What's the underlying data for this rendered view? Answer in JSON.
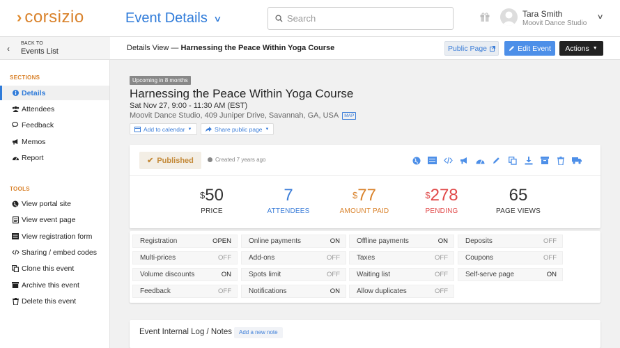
{
  "brand": {
    "name": "corsizio",
    "accent": "#d9822b",
    "link": "#2f7bd9"
  },
  "header": {
    "title": "Event Details",
    "search_placeholder": "Search",
    "user": {
      "name": "Tara Smith",
      "org": "Moovit Dance Studio"
    }
  },
  "sidebar": {
    "back_small": "BACK TO",
    "back_label": "Events List",
    "sections_label": "SECTIONS",
    "sections": [
      {
        "label": "Details",
        "icon": "info-icon"
      },
      {
        "label": "Attendees",
        "icon": "users-icon"
      },
      {
        "label": "Feedback",
        "icon": "comments-icon"
      },
      {
        "label": "Memos",
        "icon": "bullhorn-icon"
      },
      {
        "label": "Report",
        "icon": "dashboard-icon"
      }
    ],
    "tools_label": "TOOLS",
    "tools": [
      {
        "label": "View portal site",
        "icon": "globe-icon"
      },
      {
        "label": "View event page",
        "icon": "page-icon"
      },
      {
        "label": "View registration form",
        "icon": "form-icon"
      },
      {
        "label": "Sharing / embed codes",
        "icon": "code-icon"
      },
      {
        "label": "Clone this event",
        "icon": "copy-icon"
      },
      {
        "label": "Archive this event",
        "icon": "archive-icon"
      },
      {
        "label": "Delete this event",
        "icon": "trash-icon"
      }
    ]
  },
  "toolbar": {
    "crumb_prefix": "Details View — ",
    "crumb_title": "Harnessing the Peace Within Yoga Course",
    "public_page": "Public Page",
    "edit_event": "Edit Event",
    "actions": "Actions"
  },
  "event": {
    "badge": "Upcoming in 8 months",
    "title": "Harnessing the Peace Within Yoga Course",
    "date": "Sat Nov 27, 9:00 - 11:30 AM (EST)",
    "address": "Moovit Dance Studio, 409 Juniper Drive, Savannah, GA, USA",
    "map_label": "MAP",
    "add_calendar": "Add to calendar",
    "share_page": "Share public page"
  },
  "status": {
    "label": "Published",
    "created": "Created 7 years ago"
  },
  "stats": [
    {
      "prefix": "$",
      "value": "50",
      "label": "PRICE",
      "color": "#333333"
    },
    {
      "prefix": "",
      "value": "7",
      "label": "ATTENDEES",
      "color": "#3b7dd8"
    },
    {
      "prefix": "$",
      "value": "77",
      "label": "AMOUNT PAID",
      "color": "#d9822b"
    },
    {
      "prefix": "$",
      "value": "278",
      "label": "PENDING",
      "color": "#e04848"
    },
    {
      "prefix": "",
      "value": "65",
      "label": "PAGE VIEWS",
      "color": "#333333"
    }
  ],
  "features": [
    {
      "label": "Registration",
      "value": "OPEN"
    },
    {
      "label": "Online payments",
      "value": "ON"
    },
    {
      "label": "Offline payments",
      "value": "ON"
    },
    {
      "label": "Deposits",
      "value": "OFF"
    },
    {
      "label": "Multi-prices",
      "value": "OFF"
    },
    {
      "label": "Add-ons",
      "value": "OFF"
    },
    {
      "label": "Taxes",
      "value": "OFF"
    },
    {
      "label": "Coupons",
      "value": "OFF"
    },
    {
      "label": "Volume discounts",
      "value": "ON"
    },
    {
      "label": "Spots limit",
      "value": "OFF"
    },
    {
      "label": "Waiting list",
      "value": "OFF"
    },
    {
      "label": "Self-serve page",
      "value": "ON"
    },
    {
      "label": "Feedback",
      "value": "OFF"
    },
    {
      "label": "Notifications",
      "value": "ON"
    },
    {
      "label": "Allow duplicates",
      "value": "OFF"
    }
  ],
  "log": {
    "title": "Event Internal Log / Notes",
    "add_note": "Add a new note"
  }
}
